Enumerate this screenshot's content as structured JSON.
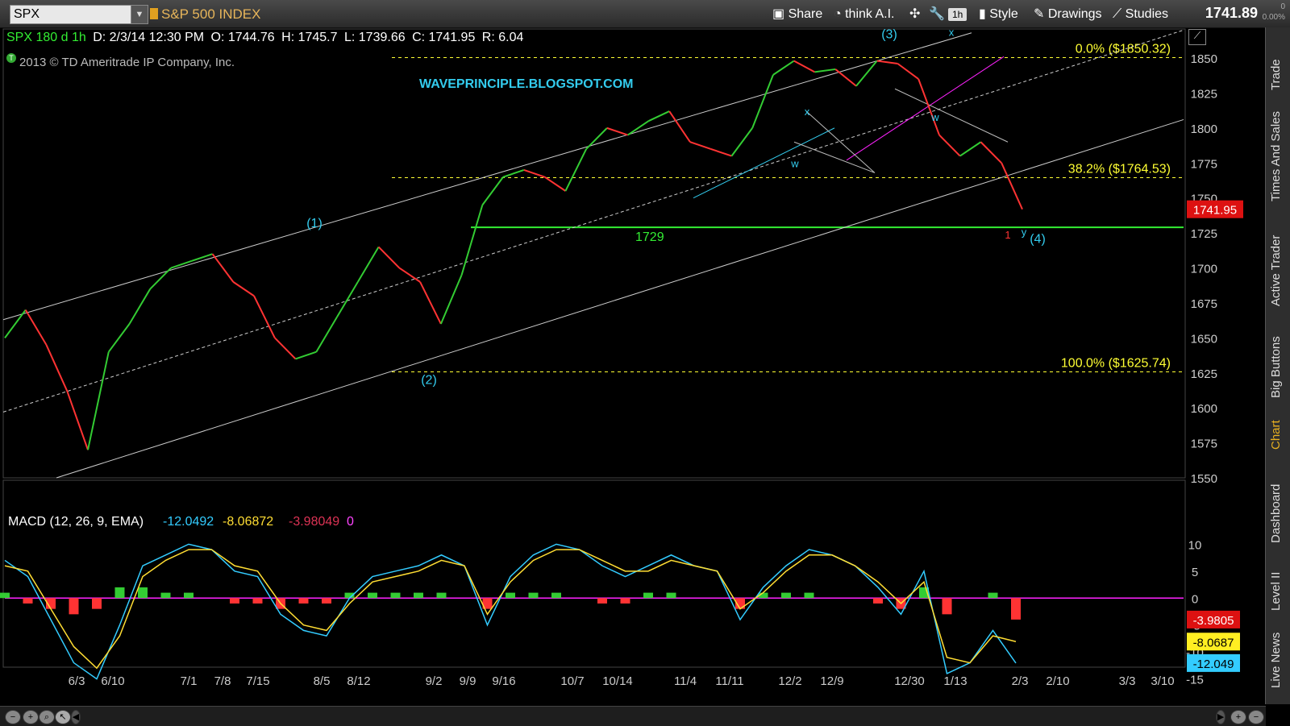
{
  "toolbar": {
    "symbol": "SPX",
    "symbol_name": "S&P 500 INDEX",
    "share": "Share",
    "think": "think A.I.",
    "interval": "1h",
    "style": "Style",
    "drawings": "Drawings",
    "studies": "Studies",
    "last_price": "1741.89",
    "change_top": "0",
    "change_bottom": "0.00%"
  },
  "sidebar": [
    "Trade",
    "Times And Sales",
    "Active Trader",
    "Big Buttons",
    "Chart",
    "Dashboard",
    "Level II",
    "Live News"
  ],
  "info": {
    "title": "SPX 180 d 1h",
    "date": "D: 2/3/14 12:30 PM",
    "open": "O: 1744.76",
    "high": "H: 1745.7",
    "low": "L: 1739.66",
    "close": "C: 1741.95",
    "range": "R: 6.04"
  },
  "copyright": "2013 © TD Ameritrade IP Company, Inc.",
  "watermark": "WAVEPRINCIPLE.BLOGSPOT.COM",
  "chart_data": [
    {
      "type": "line",
      "title": "SPX 180 d 1h",
      "x": [
        "6/3",
        "6/10",
        "7/1",
        "7/8",
        "7/15",
        "8/5",
        "8/12",
        "9/2",
        "9/9",
        "9/16",
        "10/7",
        "10/14",
        "11/4",
        "11/11",
        "12/2",
        "12/9",
        "12/30",
        "1/13",
        "2/3",
        "2/10",
        "3/3",
        "3/10"
      ],
      "ylim": [
        1550,
        1865
      ],
      "y_ticks": [
        1850,
        1825,
        1800,
        1775,
        1750,
        1725,
        1700,
        1675,
        1650,
        1625,
        1600,
        1575,
        1550
      ],
      "series": [
        {
          "values": [
            1650,
            1670,
            1645,
            1612,
            1570,
            1640,
            1660,
            1685,
            1700,
            1705,
            1710,
            1690,
            1680,
            1650,
            1635,
            1640,
            1665,
            1690,
            1715,
            1700,
            1690,
            1660,
            1695,
            1745,
            1765,
            1770,
            1765,
            1755,
            1785,
            1800,
            1795,
            1805,
            1812,
            1790,
            1785,
            1780,
            1800,
            1838,
            1848,
            1840,
            1842,
            1830,
            1848,
            1846,
            1835,
            1795,
            1780,
            1790,
            1775,
            1741.95
          ],
          "color": "#33cc33"
        }
      ],
      "current_price_label": "1741.95",
      "fib_levels": [
        {
          "label": "0.0%  ($1850.32)",
          "value": 1850.32
        },
        {
          "label": "38.2%  ($1764.53)",
          "value": 1764.53
        },
        {
          "label": "100.0%  ($1625.74)",
          "value": 1625.74
        }
      ],
      "support_line": {
        "label": "1729",
        "value": 1729
      },
      "wave_labels": [
        "(1)",
        "(2)",
        "(3)",
        "(4)",
        "x",
        "w",
        "x",
        "w",
        "1",
        "y"
      ],
      "colors": {
        "up": "#33cc33",
        "down": "#ff3333",
        "fib": "#ffff33",
        "support": "#33ee33",
        "channel": "#cccccc",
        "wave": "#33ccee",
        "count": "#ff3333",
        "magenta": "#ff22ff"
      }
    },
    {
      "type": "line",
      "title": "MACD (12, 26, 9, EMA)",
      "legend": [
        "-12.0492",
        "-8.06872",
        "-3.98049",
        "0"
      ],
      "ylim": [
        -17,
        12
      ],
      "y_ticks": [
        10,
        5,
        0,
        -5,
        -10,
        -15
      ],
      "series": [
        {
          "values": [
            7,
            4,
            -4,
            -12,
            -15,
            -5,
            6,
            8,
            10,
            9,
            5,
            4,
            -3,
            -6,
            -7,
            0,
            4,
            5,
            6,
            8,
            6,
            -5,
            4,
            8,
            10,
            9,
            6,
            4,
            6,
            8,
            6,
            5,
            -4,
            2,
            6,
            9,
            8,
            6,
            2,
            -3,
            5,
            -14,
            -12,
            -6,
            -12.0492
          ],
          "color": "#33ccff"
        },
        {
          "values": [
            6,
            5,
            -2,
            -9,
            -13,
            -7,
            4,
            7,
            9,
            9,
            6,
            5,
            -1,
            -5,
            -6,
            -1,
            3,
            4,
            5,
            7,
            6,
            -3,
            3,
            7,
            9,
            9,
            7,
            5,
            5,
            7,
            6,
            5,
            -2,
            1,
            5,
            8,
            8,
            6,
            3,
            -1,
            3,
            -11,
            -12,
            -7,
            -8.06872
          ],
          "color": "#ffdd33"
        },
        {
          "values": [
            1,
            -1,
            -2,
            -3,
            -2,
            2,
            2,
            1,
            1,
            0,
            -1,
            -1,
            -2,
            -1,
            -1,
            1,
            1,
            1,
            1,
            1,
            0,
            -2,
            1,
            1,
            1,
            0,
            -1,
            -1,
            1,
            1,
            0,
            0,
            -2,
            1,
            1,
            1,
            0,
            0,
            -1,
            -2,
            2,
            -3,
            0,
            1,
            -3.98049
          ],
          "color": "#33ee33"
        }
      ],
      "labels": [
        "-3.9805",
        "-8.0687",
        "-12.049"
      ]
    }
  ]
}
